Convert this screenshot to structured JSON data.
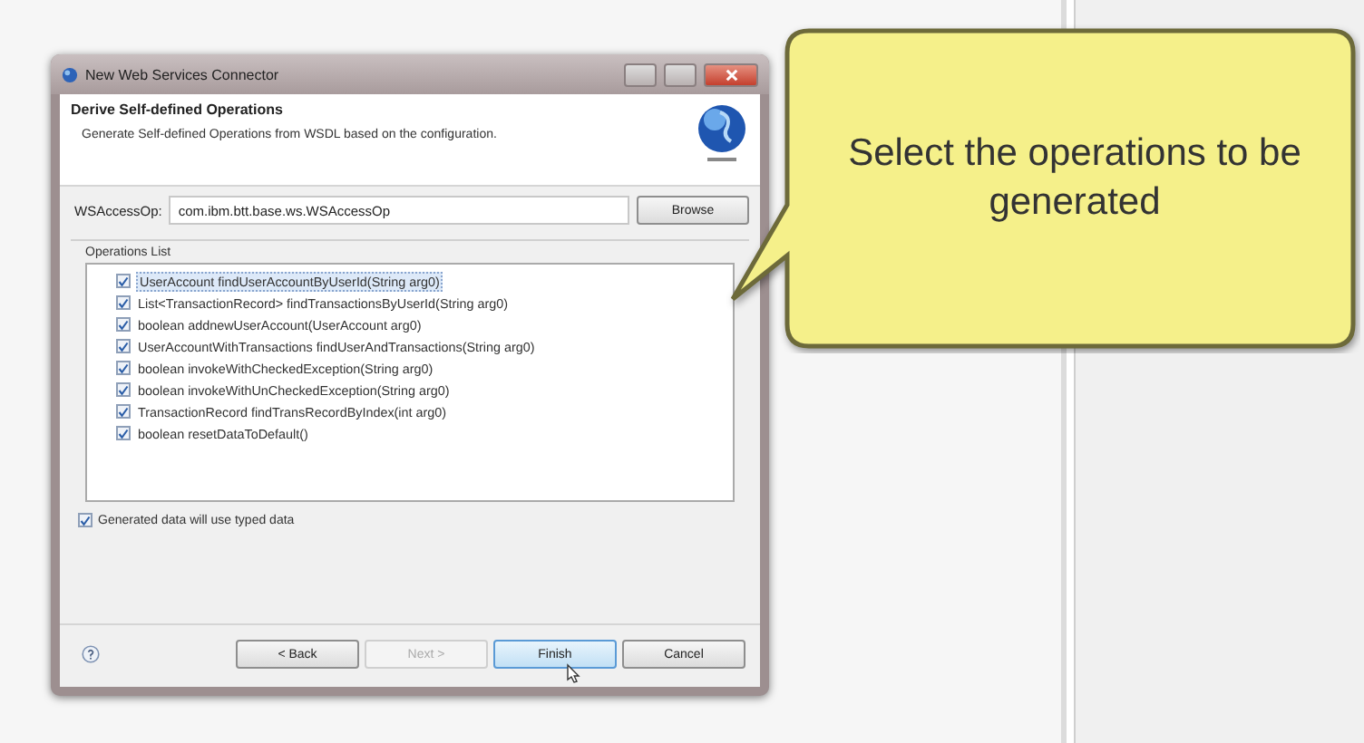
{
  "window": {
    "title": "New Web Services Connector"
  },
  "header": {
    "title": "Derive Self-defined Operations",
    "description": "Generate Self-defined Operations from WSDL based on the configuration."
  },
  "access_op": {
    "label": "WSAccessOp:",
    "value": "com.ibm.btt.base.ws.WSAccessOp",
    "button": "Browse"
  },
  "operations": {
    "label": "Operations List",
    "items": [
      {
        "label": "UserAccount findUserAccountByUserId(String arg0)",
        "checked": true,
        "selected": true
      },
      {
        "label": "List<TransactionRecord> findTransactionsByUserId(String arg0)",
        "checked": true,
        "selected": false
      },
      {
        "label": "boolean addnewUserAccount(UserAccount arg0)",
        "checked": true,
        "selected": false
      },
      {
        "label": "UserAccountWithTransactions findUserAndTransactions(String arg0)",
        "checked": true,
        "selected": false
      },
      {
        "label": "boolean invokeWithCheckedException(String arg0)",
        "checked": true,
        "selected": false
      },
      {
        "label": "boolean invokeWithUnCheckedException(String arg0)",
        "checked": true,
        "selected": false
      },
      {
        "label": "TransactionRecord findTransRecordByIndex(int arg0)",
        "checked": true,
        "selected": false
      },
      {
        "label": "boolean resetDataToDefault()",
        "checked": true,
        "selected": false
      }
    ]
  },
  "typed_data": {
    "label": "Generated data will use typed data",
    "checked": true
  },
  "buttons": [
    {
      "label": "< Back",
      "disabled": false,
      "focused": false
    },
    {
      "label": "Next >",
      "disabled": true,
      "focused": false
    },
    {
      "label": "Finish",
      "disabled": false,
      "focused": true
    },
    {
      "label": "Cancel",
      "disabled": false,
      "focused": false
    }
  ],
  "callout": {
    "text": "Select the operations to be generated"
  }
}
